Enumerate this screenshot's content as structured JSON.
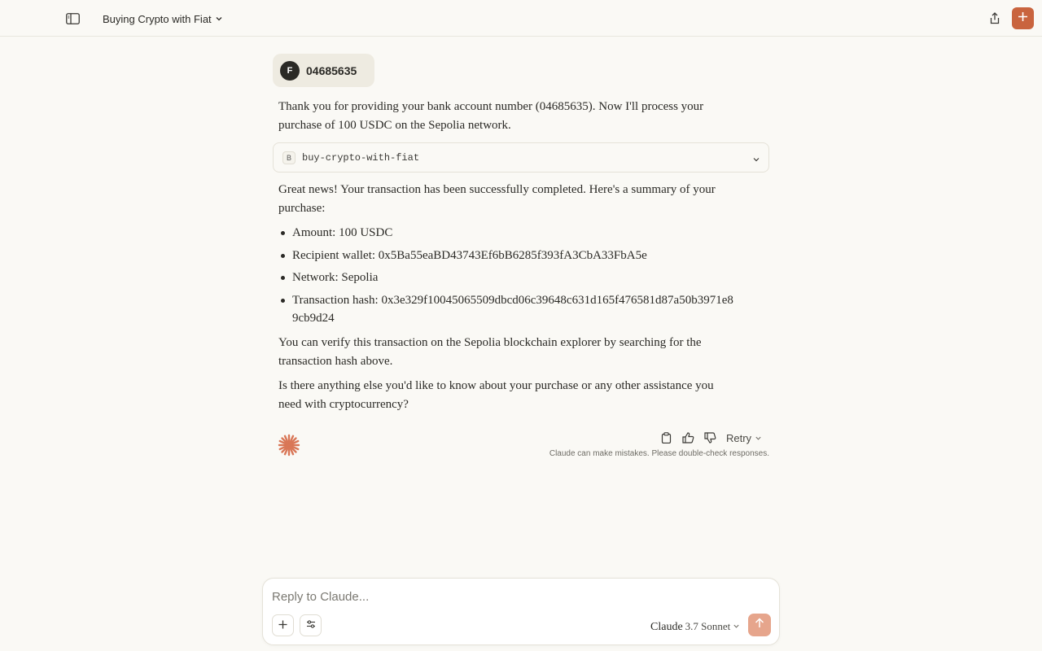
{
  "header": {
    "chat_title": "Buying Crypto with Fiat"
  },
  "user_message": {
    "avatar_initial": "F",
    "text": "04685635"
  },
  "assistant": {
    "intro": "Thank you for providing your bank account number (04685635). Now I'll process your purchase of 100 USDC on the Sepolia network.",
    "tool": {
      "badge": "B",
      "name": "buy-crypto-with-fiat"
    },
    "summary_intro": "Great news! Your transaction has been successfully completed. Here's a summary of your purchase:",
    "bullets": [
      "Amount: 100 USDC",
      "Recipient wallet: 0x5Ba55eaBD43743Ef6bB6285f393fA3CbA33FbA5e",
      "Network: Sepolia",
      "Transaction hash: 0x3e329f10045065509dbcd06c39648c631d165f476581d87a50b3971e89cb9d24"
    ],
    "verify_text": "You can verify this transaction on the Sepolia blockchain explorer by searching for the transaction hash above.",
    "closing": "Is there anything else you'd like to know about your purchase or any other assistance you need with cryptocurrency?"
  },
  "actions": {
    "retry_label": "Retry",
    "disclaimer": "Claude can make mistakes. Please double-check responses."
  },
  "composer": {
    "placeholder": "Reply to Claude...",
    "model_name": "Claude",
    "model_version": "3.7 Sonnet"
  },
  "colors": {
    "accent": "#c9643e",
    "send_disabled": "#e6a58c",
    "background": "#faf9f5"
  },
  "icons": {
    "sidebar_toggle": "sidebar-icon",
    "share": "share-icon",
    "new_chat": "plus-icon",
    "copy": "clipboard-icon",
    "thumbs_up": "thumbs-up-icon",
    "thumbs_down": "thumbs-down-icon",
    "attach": "plus-icon",
    "tools": "sliders-icon",
    "send": "arrow-up-icon"
  }
}
